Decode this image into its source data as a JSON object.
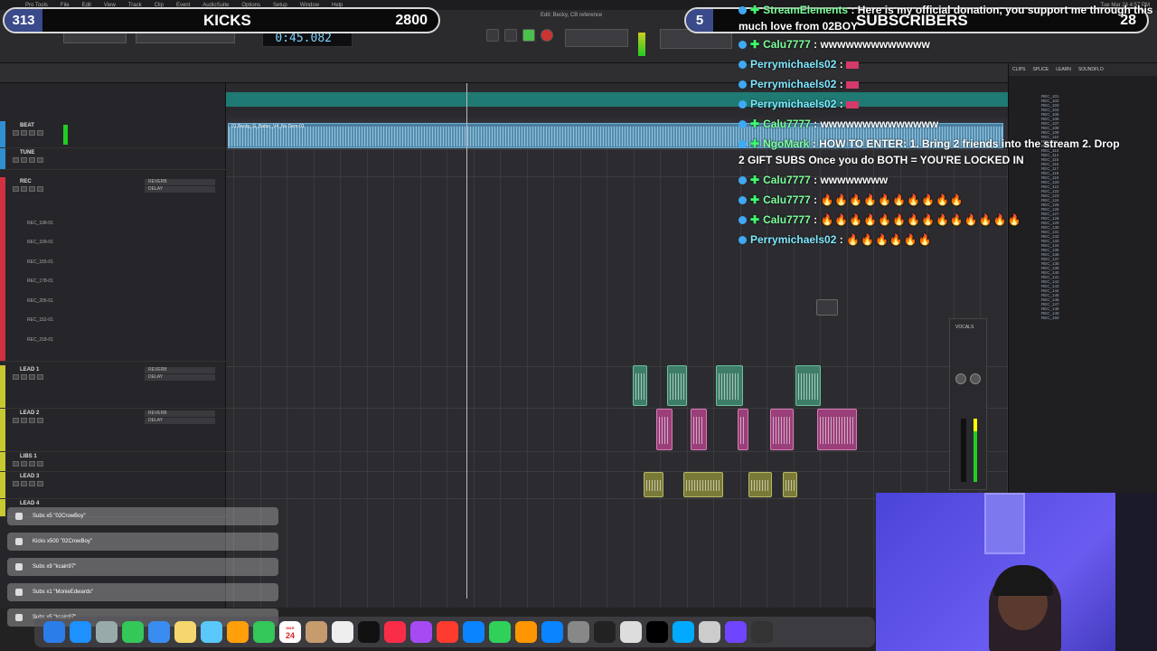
{
  "daw": {
    "menu_items": [
      "Pro Tools",
      "File",
      "Edit",
      "View",
      "Track",
      "Clip",
      "Event",
      "AudioSuite",
      "Options",
      "Setup",
      "Window",
      "Help"
    ],
    "window_title": "Edit: Becky, CB reference",
    "counter": "0:45.082",
    "clock": "Tue Mar 24  4:57 PM",
    "beat_clip_label": "01 Becky_G_Batter_V4_No Dem-01",
    "clip_list_tabs": [
      "CLIPS",
      "SPLICE",
      "LEARN",
      "SOUNDFLO"
    ],
    "tracks": [
      {
        "name": "BEAT",
        "color": "#2f8fd0"
      },
      {
        "name": "TUNE",
        "color": "#2f8fd0"
      },
      {
        "name": "REC",
        "color": "#d03040"
      },
      {
        "name": "LEAD 1",
        "color": "#c8c830"
      },
      {
        "name": "LEAD 2",
        "color": "#c8c830"
      },
      {
        "name": "LIBS 1",
        "color": "#c8c830"
      },
      {
        "name": "LEAD 3",
        "color": "#c8c830"
      },
      {
        "name": "LEAD 4",
        "color": "#c8c830"
      }
    ],
    "rec_subtracks": [
      "REC_108-01",
      "REC_109-01",
      "REC_155-01",
      "REC_178-01",
      "REC_205-01",
      "REC_152-01",
      "REC_218-01"
    ],
    "inserts": [
      "REVERB",
      "DELAY"
    ],
    "clip_items": [
      "REC_101",
      "REC_102",
      "REC_103",
      "REC_104",
      "REC_105",
      "REC_106",
      "REC_107",
      "REC_108",
      "REC_109",
      "REC_110",
      "REC_111",
      "REC_112",
      "REC_113",
      "REC_114",
      "REC_115",
      "REC_116",
      "REC_117",
      "REC_118",
      "REC_119",
      "REC_120",
      "REC_121",
      "REC_122",
      "REC_123",
      "REC_124",
      "REC_125",
      "REC_126",
      "REC_127",
      "REC_128",
      "REC_129",
      "REC_130",
      "REC_131",
      "REC_132",
      "REC_133",
      "REC_134",
      "REC_135",
      "REC_136",
      "REC_137",
      "REC_138",
      "REC_139",
      "REC_140",
      "REC_141",
      "REC_142",
      "REC_143",
      "REC_144",
      "REC_145",
      "REC_146",
      "REC_147",
      "REC_148",
      "REC_149",
      "REC_150"
    ]
  },
  "overlay": {
    "kicks": {
      "count": "313",
      "label": "KICKS",
      "goal": "2800"
    },
    "subs": {
      "count": "5",
      "label": "SUBSCRIBERS",
      "goal": "28"
    },
    "chat": [
      {
        "user": "StreamElements",
        "text": "Here is my official donation, you support me through this",
        "style": "green"
      },
      {
        "user": "",
        "text": "much love from 02BOY",
        "style": "plain"
      },
      {
        "user": "Calu7777",
        "text": "wwwwwwwwwwwww",
        "style": "green"
      },
      {
        "user": "Perrymichaels02",
        "text": "",
        "style": "blue",
        "flag": true
      },
      {
        "user": "Perrymichaels02",
        "text": "",
        "style": "blue",
        "flag": true
      },
      {
        "user": "Perrymichaels02",
        "text": "",
        "style": "blue",
        "flag": true
      },
      {
        "user": "Calu7777",
        "text": "wwwwwwwwwwwwww",
        "style": "green"
      },
      {
        "user": "NgoMark",
        "text": "HOW TO ENTER: 1. Bring 2 friends into the stream 2. Drop",
        "style": "green"
      },
      {
        "user": "",
        "text": "2 GIFT SUBS  Once you do BOTH = YOU'RE LOCKED IN",
        "style": "plain"
      },
      {
        "user": "Calu7777",
        "text": "wwwwwwww",
        "style": "green"
      },
      {
        "user": "Calu7777",
        "text": "🔥🔥🔥🔥🔥🔥🔥🔥🔥🔥",
        "style": "green"
      },
      {
        "user": "Calu7777",
        "text": "🔥🔥🔥🔥🔥🔥🔥🔥🔥🔥🔥🔥🔥🔥",
        "style": "green"
      },
      {
        "user": "Perrymichaels02",
        "text": "🔥🔥🔥🔥🔥🔥",
        "style": "blue"
      }
    ],
    "alerts": [
      "Subs x5 \"02CrowBoy\"",
      "Kicks x500 \"02CrowBoy\"",
      "Subs x9 \"kcain97\"",
      "Subs x1 \"MonieEdwards\"",
      "Subs x5 \"kcain97\""
    ]
  },
  "dock": {
    "calendar_month": "MAR",
    "calendar_day": "24",
    "apps": [
      "finder-icon",
      "safari-icon",
      "launchpad-icon",
      "messages-icon",
      "mail-icon",
      "notes-icon",
      "maps-icon",
      "photos-icon",
      "facetime-icon",
      "calendar-icon",
      "box-icon",
      "reminders-icon",
      "tv-icon",
      "music-icon",
      "podcasts-icon",
      "news-icon",
      "keynote-icon",
      "numbers-icon",
      "pages-icon",
      "appstore-icon",
      "settings-icon",
      "quicktime-icon",
      "logic-icon",
      "ilok-icon",
      "circle-app-icon",
      "compressor-icon",
      "avid-icon",
      "plugin-icon"
    ]
  }
}
